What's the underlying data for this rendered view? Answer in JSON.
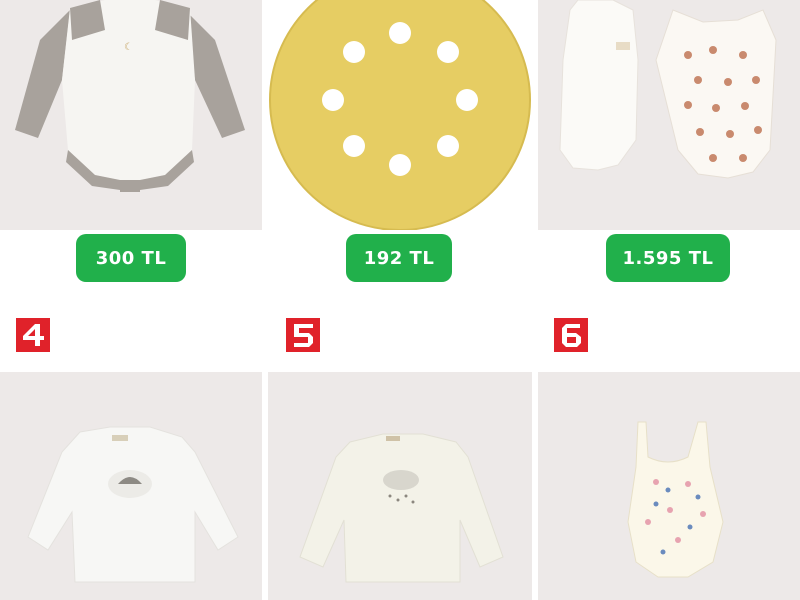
{
  "products": [
    {
      "price": "300 TL",
      "image": "baby-bodysuit-gray-sleeves"
    },
    {
      "price": "192 TL",
      "image": "yellow-sanding-disc"
    },
    {
      "price": "1.595 TL",
      "image": "two-baby-bodysuits"
    },
    {
      "rank": "4",
      "image": "white-baby-longsleeve-top"
    },
    {
      "rank": "5",
      "image": "cream-baby-longsleeve-cloud-print"
    },
    {
      "rank": "6",
      "image": "baby-singlet-bodysuit-floral"
    }
  ],
  "colors": {
    "price_badge": "#21b04b",
    "rank_badge": "#e0222a",
    "card_background": "#ede9e8"
  }
}
